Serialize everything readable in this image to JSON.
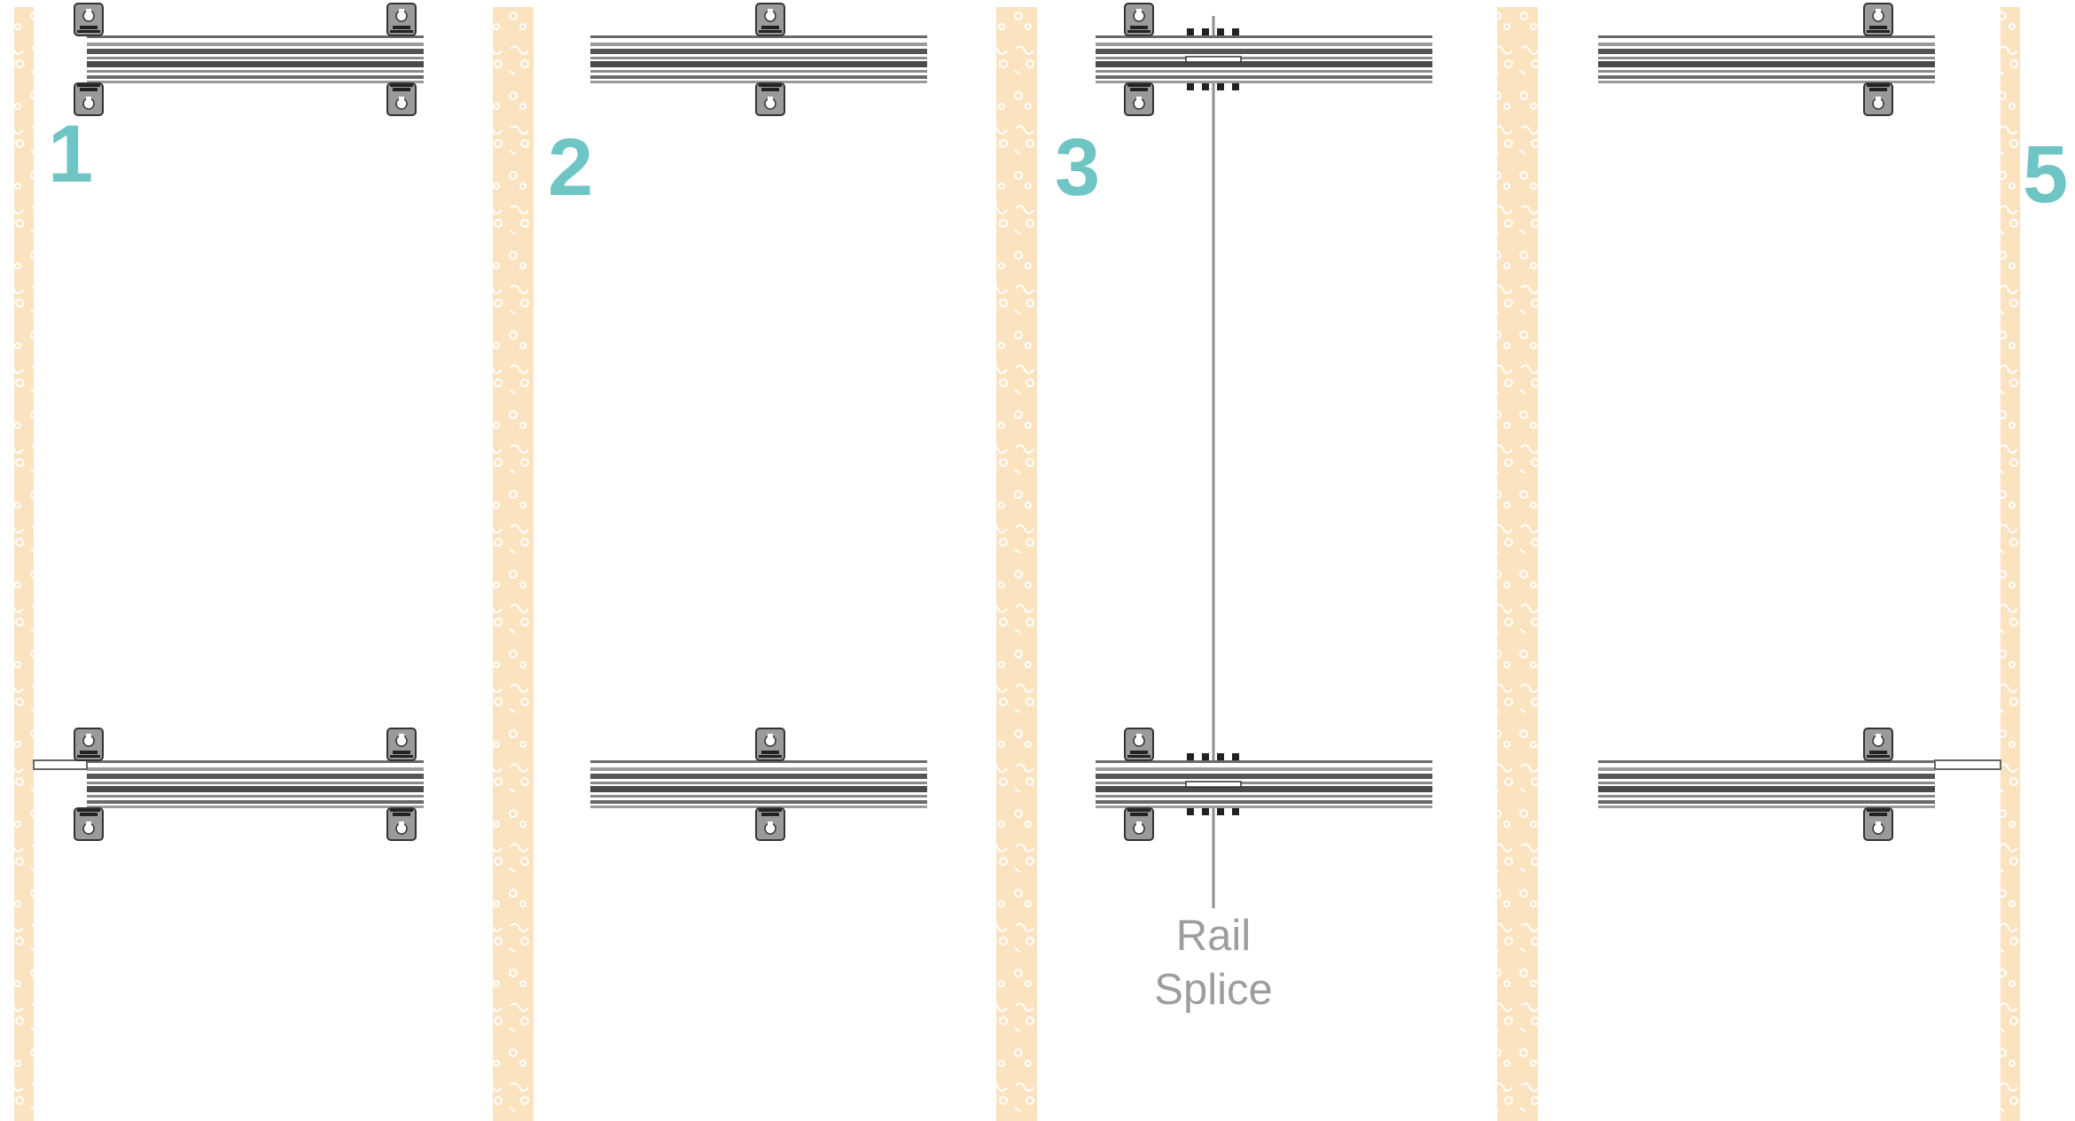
{
  "diagram": {
    "panel_numbers": [
      "1",
      "2",
      "3",
      "5"
    ],
    "splice_label_line1": "Rail",
    "splice_label_line2": "Splice"
  },
  "colors": {
    "stud": "#fbe3c0",
    "accent_number": "#6ec5c4",
    "rail_dark": "#5a5a5a",
    "clip": "#8f8f8f",
    "label": "#9d9d9d"
  }
}
